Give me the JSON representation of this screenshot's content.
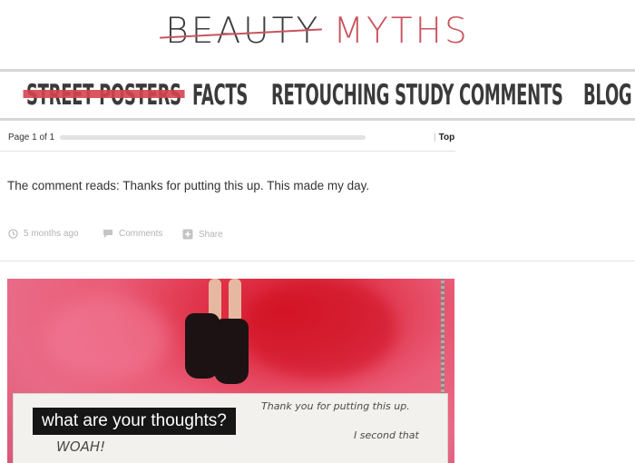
{
  "site": {
    "logo_word1": "BEAUTY",
    "logo_word2": "MYTHS",
    "accent_color": "#c9545f"
  },
  "nav": {
    "items": [
      {
        "label": "STREET POSTERS",
        "active": true
      },
      {
        "label": "FACTS",
        "active": false
      },
      {
        "label": "RETOUCHING STUDY",
        "active": false
      },
      {
        "label": "COMMENTS",
        "active": false
      },
      {
        "label": "BLOG",
        "active": false
      }
    ]
  },
  "pager": {
    "label": "Page 1 of 1",
    "top_label": "Top"
  },
  "post": {
    "text": "The comment reads: Thanks for putting this up. This made my day.",
    "meta": {
      "time": "5 months ago",
      "comments": "Comments",
      "share": "Share"
    }
  },
  "photo": {
    "question": "what are your thoughts?",
    "handwriting_1": "Thank you for putting this up.",
    "handwriting_2": "I second that",
    "handwriting_3": "WOAH!"
  },
  "icons": [
    "clock-icon",
    "comment-icon",
    "share-icon"
  ]
}
